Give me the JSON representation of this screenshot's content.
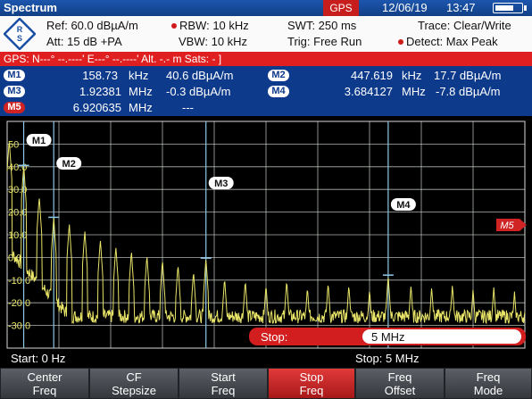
{
  "title_bar": {
    "app": "Spectrum",
    "gps_badge": "GPS",
    "date": "12/06/19",
    "time": "13:47"
  },
  "params": {
    "ref": "Ref:  60.0 dBµA/m",
    "rbw": "RBW:   10 kHz",
    "swt": "SWT:   250 ms",
    "trace": "Trace:   Clear/Write",
    "att": "Att:  15 dB +PA",
    "vbw": "VBW:   10 kHz",
    "trig": "Trig:   Free Run",
    "detect": "Detect:  Max Peak"
  },
  "gps_status": "GPS:  N---° --.----'   E---° --.----'    Alt.  -.-  m   Sats: -  ]",
  "markers": {
    "m1": {
      "label": "M1",
      "freq": "158.73",
      "unit": "kHz",
      "level": "40.6  dBµA/m"
    },
    "m2": {
      "label": "M2",
      "freq": "447.619",
      "unit": "kHz",
      "level": "17.7  dBµA/m"
    },
    "m3": {
      "label": "M3",
      "freq": "1.92381",
      "unit": "MHz",
      "level": "-0.3  dBµA/m"
    },
    "m4": {
      "label": "M4",
      "freq": "3.684127",
      "unit": "MHz",
      "level": "-7.8  dBµA/m"
    },
    "m5": {
      "label": "M5",
      "freq": "6.920635",
      "unit": "MHz",
      "level": "---"
    }
  },
  "plot_markers": [
    "M1",
    "M2",
    "M3",
    "M4",
    "M5"
  ],
  "chart_data": {
    "type": "line",
    "xlabel": "",
    "ylabel": "",
    "x_range_mhz": [
      0,
      5
    ],
    "ylim": [
      -40,
      60
    ],
    "y_ticks": [
      50,
      40,
      30,
      20,
      10,
      0,
      -10,
      -20,
      -30
    ],
    "y_tick_labels": [
      "50",
      "40.0",
      "30.0",
      "20.0",
      "10.0",
      "0.0",
      "-10.0",
      "-20.0",
      "-30.0"
    ],
    "grid": true,
    "noise_floor": -26,
    "peaks": [
      {
        "x": 0.02,
        "y": 52
      },
      {
        "x": 0.16,
        "y": 40.6
      },
      {
        "x": 0.31,
        "y": 27
      },
      {
        "x": 0.45,
        "y": 17.7
      },
      {
        "x": 0.6,
        "y": 15
      },
      {
        "x": 0.75,
        "y": 12
      },
      {
        "x": 0.9,
        "y": 8
      },
      {
        "x": 1.05,
        "y": 5
      },
      {
        "x": 1.2,
        "y": 3
      },
      {
        "x": 1.35,
        "y": 1
      },
      {
        "x": 1.5,
        "y": -1
      },
      {
        "x": 1.65,
        "y": -3
      },
      {
        "x": 1.8,
        "y": -6
      },
      {
        "x": 1.92,
        "y": -0.3
      },
      {
        "x": 2.1,
        "y": -9
      },
      {
        "x": 2.3,
        "y": -10
      },
      {
        "x": 2.5,
        "y": -12
      },
      {
        "x": 2.7,
        "y": -10
      },
      {
        "x": 2.9,
        "y": -13
      },
      {
        "x": 3.1,
        "y": -11
      },
      {
        "x": 3.3,
        "y": -12
      },
      {
        "x": 3.5,
        "y": -14
      },
      {
        "x": 3.68,
        "y": -7.8
      },
      {
        "x": 3.9,
        "y": -12
      },
      {
        "x": 4.1,
        "y": -13
      },
      {
        "x": 4.3,
        "y": -12
      },
      {
        "x": 4.5,
        "y": -14
      },
      {
        "x": 4.7,
        "y": -13
      },
      {
        "x": 4.9,
        "y": -15
      }
    ],
    "marker_positions": [
      {
        "label": "M1",
        "x": 0.16,
        "y": 40.6
      },
      {
        "label": "M2",
        "x": 0.45,
        "y": 17.7
      },
      {
        "label": "M3",
        "x": 1.92,
        "y": -0.3
      },
      {
        "label": "M4",
        "x": 3.68,
        "y": -7.8
      }
    ]
  },
  "stop_input": {
    "label": "Stop:",
    "value": "5 MHz"
  },
  "footer": {
    "start": "Start:  0 Hz",
    "stop": "Stop: 5 MHz"
  },
  "softkeys": [
    {
      "line1": "Center",
      "line2": "Freq"
    },
    {
      "line1": "CF",
      "line2": "Stepsize"
    },
    {
      "line1": "Start",
      "line2": "Freq"
    },
    {
      "line1": "Stop",
      "line2": "Freq"
    },
    {
      "line1": "Freq",
      "line2": "Offset"
    },
    {
      "line1": "Freq",
      "line2": "Mode"
    }
  ],
  "colors": {
    "trace": "#e8e468",
    "grid": "#ffffff",
    "accent_red": "#e02020",
    "marker_blue": "#0e3a8c"
  }
}
